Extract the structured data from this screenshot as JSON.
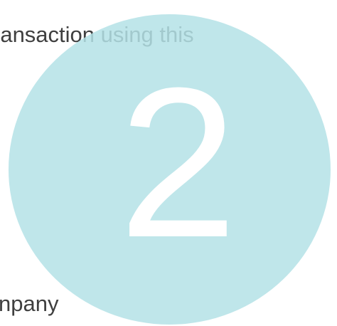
{
  "content": {
    "top_text": "ransaction using this",
    "bottom_text": "npany"
  },
  "step_badge": {
    "number": "2",
    "color": "#b4e2e6"
  }
}
